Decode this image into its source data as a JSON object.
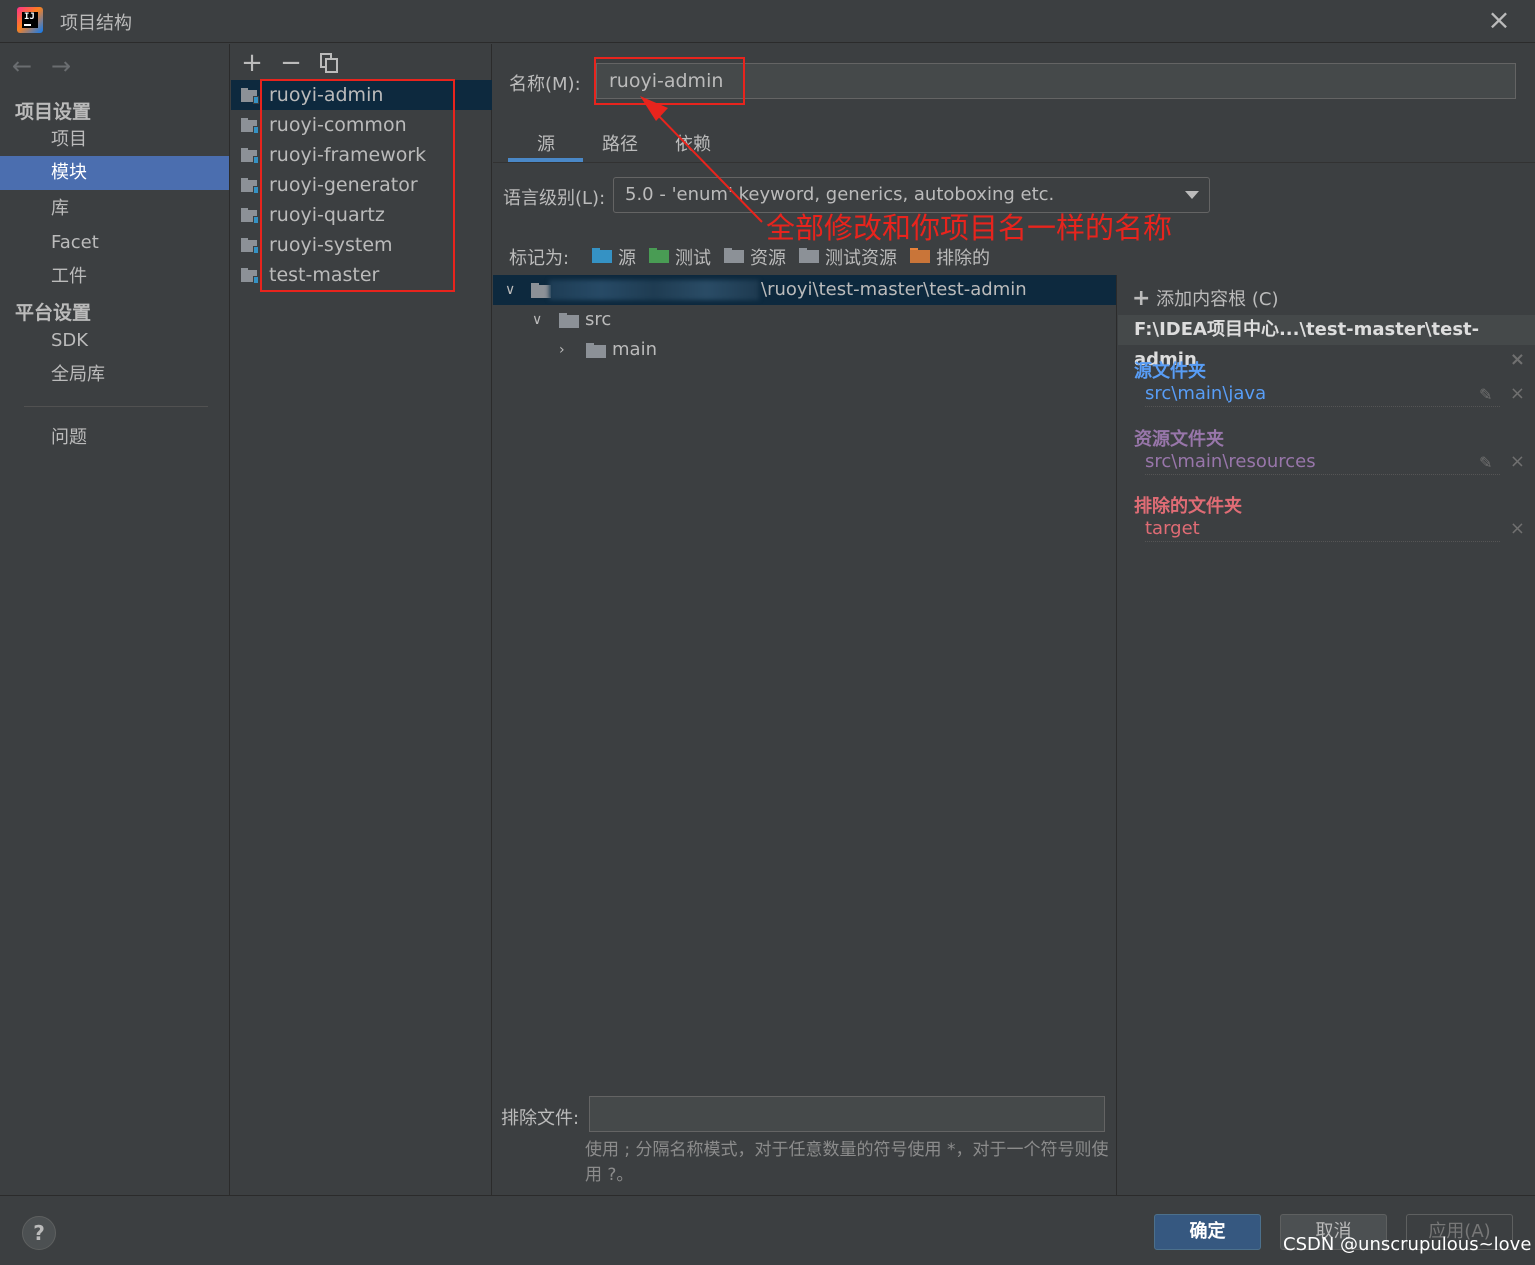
{
  "window": {
    "title": "项目结构",
    "close_icon": "close-icon"
  },
  "nav": {
    "back_icon": "←",
    "forward_icon": "→",
    "project_settings_heading": "项目设置",
    "project_settings_items": [
      "项目",
      "模块",
      "库",
      "Facet",
      "工件"
    ],
    "platform_settings_heading": "平台设置",
    "platform_settings_items": [
      "SDK",
      "全局库"
    ],
    "problems": "问题",
    "selected": "模块"
  },
  "modules": {
    "toolbar": {
      "add": "+",
      "remove": "−"
    },
    "items": [
      "ruoyi-admin",
      "ruoyi-common",
      "ruoyi-framework",
      "ruoyi-generator",
      "ruoyi-quartz",
      "ruoyi-system",
      "test-master"
    ],
    "selected": "ruoyi-admin"
  },
  "main": {
    "name_label": "名称(M):",
    "name_value": "ruoyi-admin",
    "tabs": [
      "源",
      "路径",
      "依赖"
    ],
    "active_tab": "源",
    "language_level_label": "语言级别(L):",
    "language_level_value": "5.0 - 'enum' keyword, generics, autoboxing etc.",
    "mark_as_label": "标记为:",
    "mark_as": [
      {
        "label": "源",
        "color": "#3592c4"
      },
      {
        "label": "测试",
        "color": "#499c54"
      },
      {
        "label": "资源",
        "color": "#8c9197"
      },
      {
        "label": "测试资源",
        "color": "#8c9197"
      },
      {
        "label": "排除的",
        "color": "#e8823a"
      }
    ],
    "tree": {
      "root_path": "\\ruoyi\\test-master\\test-admin",
      "src": "src",
      "main": "main"
    },
    "exclude_label": "排除文件:",
    "exclude_value": "",
    "hint": "使用 ; 分隔名称模式，对于任意数量的符号使用 *，对于一个符号则使用 ?。"
  },
  "roots": {
    "add_content_root": "添加内容根 (C)",
    "root_path": "F:\\IDEA项目中心...\\test-master\\test-admin",
    "source_title": "源文件夹",
    "source_path": "src\\main\\java",
    "source_color": "#589df6",
    "resource_title": "资源文件夹",
    "resource_path": "src\\main\\resources",
    "resource_color": "#9876aa",
    "excluded_title": "排除的文件夹",
    "excluded_path": "target",
    "excluded_color": "#e06c75"
  },
  "footer": {
    "help": "?",
    "ok": "确定",
    "cancel": "取消",
    "apply": "应用(A)",
    "watermark": "CSDN @unscrupulous~love"
  },
  "annotation": {
    "text": "全部修改和你项目名一样的名称",
    "color": "#e8241d"
  }
}
